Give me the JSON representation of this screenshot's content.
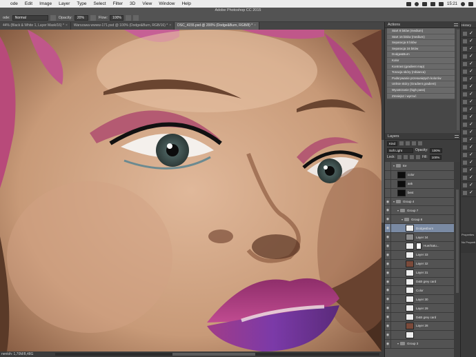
{
  "menubar": {
    "items": [
      "ode",
      "Edit",
      "Image",
      "Layer",
      "Type",
      "Select",
      "Filter",
      "3D",
      "View",
      "Window",
      "Help"
    ],
    "clock": "15:21"
  },
  "options": {
    "app_title": "Adobe Photoshop CC 2015",
    "mode_label": "ode:",
    "mode_value": "Normal",
    "opacity_label": "Opacity:",
    "opacity_value": "20%",
    "flow_label": "Flow:",
    "flow_value": "100%"
  },
  "tabs": [
    {
      "label": "44% (Black & White 1, Layer Mask/16) *",
      "active": false
    },
    {
      "label": "Warszawa wwww-171.psd @ 100% (Dodge&Burn, RGB/16) *",
      "active": false
    },
    {
      "label": "DSC_4155.psd @ 200% (Dodge&Burn, RGB/8) *",
      "active": true
    }
  ],
  "status": {
    "text": "nenkih: 1,70M/8,48G"
  },
  "actions": {
    "title": "Actions",
    "items": [
      "Start 8 bitów (medium)",
      "Start 16 bitów (medium)",
      "Separacja 8 bitów",
      "Separacja 16 bitów",
      "Dodge&Burn",
      "Kolor",
      "Kontrast (gradient map)",
      "Tonacja skóry (mbianca)",
      "Podsrywanie przesuniętych kolorów",
      "Utrlnie skóry (Gradient gradient)",
      "Wyostrzanie (high pass)",
      "Zmniejsz i wyrzuć"
    ]
  },
  "layers": {
    "title": "Layers",
    "kind": "Kind",
    "blend": "Soft Light",
    "opacity_label": "Opacity:",
    "opacity_value": "100%",
    "lock_label": "Lock:",
    "fill_label": "Fill:",
    "fill_value": "100%",
    "rows": [
      {
        "name": "Ee",
        "type": "group",
        "indent": 0,
        "eye": false,
        "selected": false
      },
      {
        "name": "color",
        "type": "dark",
        "indent": 1,
        "eye": false,
        "selected": false
      },
      {
        "name": "ank",
        "type": "dark",
        "indent": 1,
        "eye": false,
        "selected": false
      },
      {
        "name": "best",
        "type": "dark",
        "indent": 1,
        "eye": false,
        "selected": false
      },
      {
        "name": "Group 4",
        "type": "group",
        "indent": 0,
        "eye": true,
        "selected": false
      },
      {
        "name": "Group 7",
        "type": "group",
        "indent": 1,
        "eye": true,
        "selected": false
      },
      {
        "name": "Group 8",
        "type": "group",
        "indent": 2,
        "eye": true,
        "selected": false
      },
      {
        "name": "Dodge&burn",
        "type": "white",
        "indent": 3,
        "eye": true,
        "selected": true
      },
      {
        "name": "Layer 34",
        "type": "grey",
        "indent": 3,
        "eye": true,
        "selected": false
      },
      {
        "name": "Hue/Satu...",
        "type": "mask",
        "indent": 3,
        "eye": true,
        "selected": false
      },
      {
        "name": "Layer 33",
        "type": "white",
        "indent": 3,
        "eye": true,
        "selected": false
      },
      {
        "name": "Layer 32",
        "type": "face",
        "indent": 3,
        "eye": true,
        "selected": false
      },
      {
        "name": "Layer 31",
        "type": "white",
        "indent": 3,
        "eye": true,
        "selected": false
      },
      {
        "name": "D&B grey card",
        "type": "white",
        "indent": 3,
        "eye": true,
        "selected": false
      },
      {
        "name": "Color",
        "type": "white",
        "indent": 3,
        "eye": true,
        "selected": false
      },
      {
        "name": "Layer 30",
        "type": "white",
        "indent": 3,
        "eye": true,
        "selected": false
      },
      {
        "name": "Layer 29",
        "type": "white",
        "indent": 3,
        "eye": true,
        "selected": false
      },
      {
        "name": "D&B grey card",
        "type": "white",
        "indent": 3,
        "eye": true,
        "selected": false
      },
      {
        "name": "Layer 28",
        "type": "face",
        "indent": 3,
        "eye": true,
        "selected": false
      },
      {
        "name": "",
        "type": "white",
        "indent": 3,
        "eye": true,
        "selected": false
      },
      {
        "name": "Group 3",
        "type": "group",
        "indent": 1,
        "eye": true,
        "selected": false
      }
    ]
  },
  "farright": {
    "history_label": "History",
    "properties_label": "Properties",
    "no_properties": "No Properti"
  }
}
